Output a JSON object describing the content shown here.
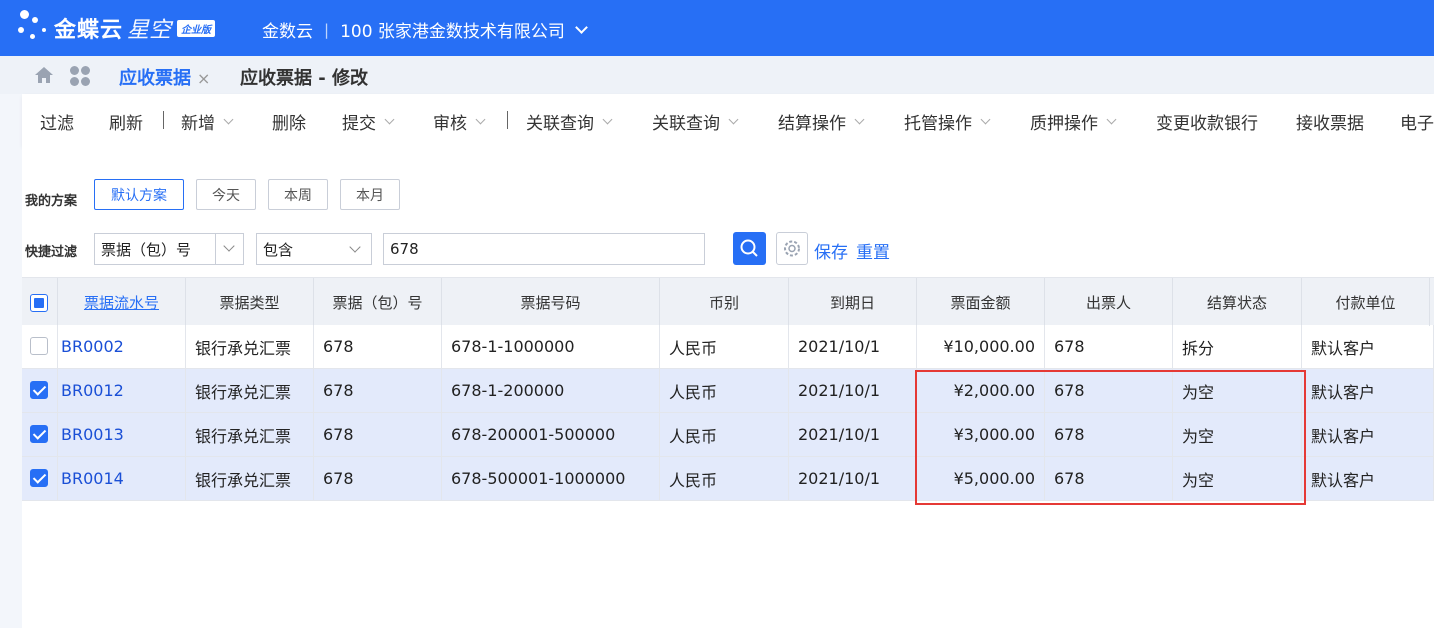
{
  "brand": {
    "name": "金蝶云",
    "sub": "星空",
    "badge": "企业版"
  },
  "header": {
    "cloud": "金数云",
    "org": "100 张家港金数技术有限公司"
  },
  "tabs": [
    {
      "label": "应收票据",
      "close": "×"
    },
    {
      "label": "应收票据 - 修改"
    }
  ],
  "toolbar": {
    "items": [
      "过滤",
      "刷新",
      "新增",
      "删除",
      "提交",
      "审核",
      "关联查询",
      "关联查询",
      "结算操作",
      "托管操作",
      "质押操作",
      "变更收款银行",
      "接收票据",
      "电子"
    ]
  },
  "filter": {
    "scheme_label": "我的方案",
    "schemes": [
      "默认方案",
      "今天",
      "本周",
      "本月"
    ],
    "quick_label": "快捷过滤",
    "field": "票据（包）号",
    "operator": "包含",
    "value": "678",
    "save": "保存",
    "reset": "重置"
  },
  "table": {
    "headers": [
      "票据流水号",
      "票据类型",
      "票据（包）号",
      "票据号码",
      "币别",
      "到期日",
      "票面金额",
      "出票人",
      "结算状态",
      "付款单位"
    ],
    "rows": [
      {
        "checked": false,
        "cells": [
          "BR0002",
          "银行承兑汇票",
          "678",
          "678-1-1000000",
          "人民币",
          "2021/10/1",
          "¥10,000.00",
          "678",
          "拆分",
          "默认客户"
        ]
      },
      {
        "checked": true,
        "cells": [
          "BR0012",
          "银行承兑汇票",
          "678",
          "678-1-200000",
          "人民币",
          "2021/10/1",
          "¥2,000.00",
          "678",
          "为空",
          "默认客户"
        ]
      },
      {
        "checked": true,
        "cells": [
          "BR0013",
          "银行承兑汇票",
          "678",
          "678-200001-500000",
          "人民币",
          "2021/10/1",
          "¥3,000.00",
          "678",
          "为空",
          "默认客户"
        ]
      },
      {
        "checked": true,
        "cells": [
          "BR0014",
          "银行承兑汇票",
          "678",
          "678-500001-1000000",
          "人民币",
          "2021/10/1",
          "¥5,000.00",
          "678",
          "为空",
          "默认客户"
        ]
      }
    ]
  },
  "colors": {
    "primary": "#276ff5",
    "highlight": "#e53935",
    "selected_row": "#e3eafb"
  }
}
